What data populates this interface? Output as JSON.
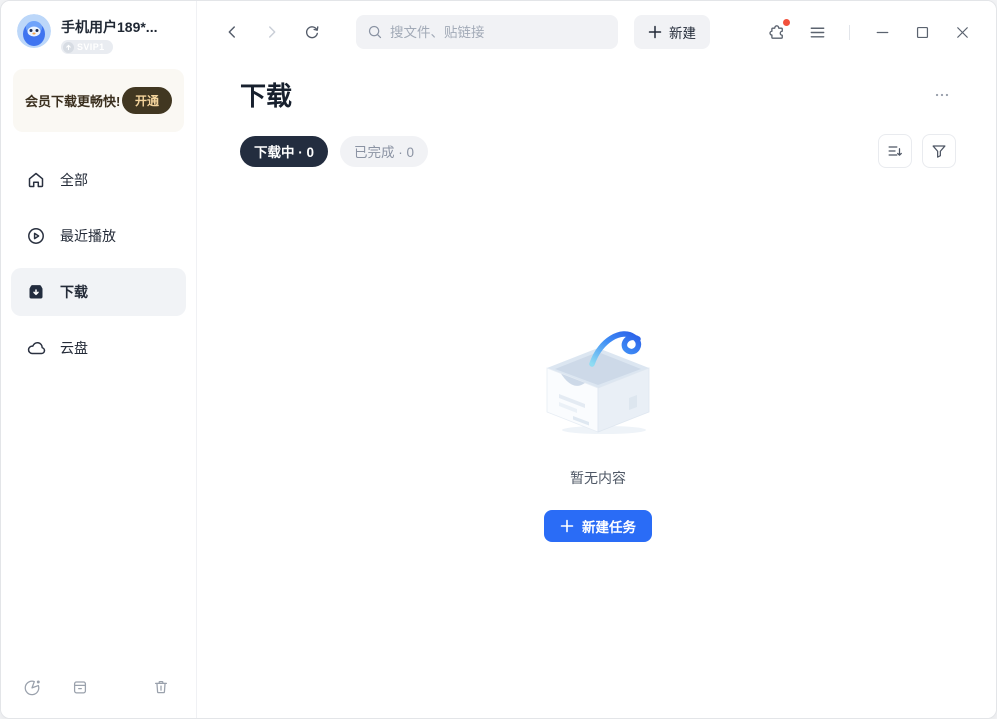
{
  "sidebar": {
    "profile": {
      "name": "手机用户189*...",
      "badge": "SVIP1"
    },
    "vip_card": {
      "text": "会员下载更畅快!",
      "action": "开通"
    },
    "items": [
      {
        "label": "全部"
      },
      {
        "label": "最近播放"
      },
      {
        "label": "下载"
      },
      {
        "label": "云盘"
      }
    ]
  },
  "topbar": {
    "search_placeholder": "搜文件、贴链接",
    "new_button": "新建"
  },
  "content": {
    "title": "下载",
    "tabs": [
      {
        "label": "下载中 · 0"
      },
      {
        "label": "已完成 · 0"
      }
    ],
    "empty": {
      "message": "暂无内容",
      "action": "新建任务"
    }
  },
  "colors": {
    "accent_blue": "#2a6cf6",
    "tab_active_bg": "#232d3f",
    "vip_button_bg": "#413721",
    "vip_gold": "#f3d39b",
    "notification_red": "#f2503c"
  }
}
